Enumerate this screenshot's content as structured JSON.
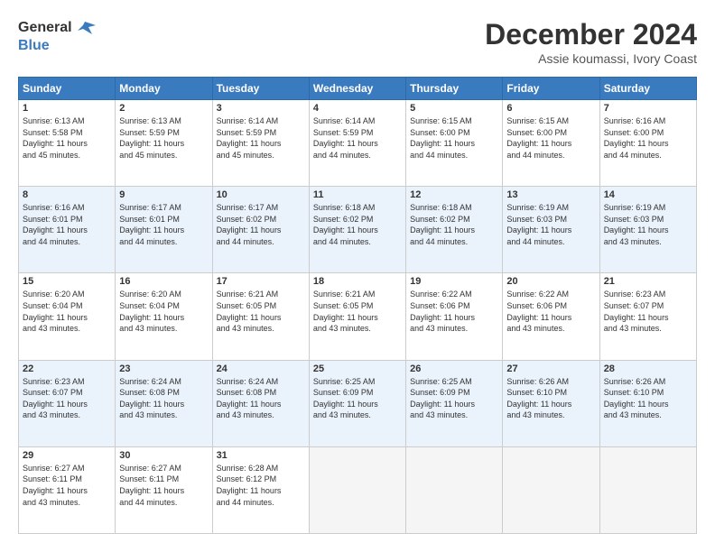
{
  "logo": {
    "line1": "General",
    "line2": "Blue"
  },
  "header": {
    "month": "December 2024",
    "location": "Assie koumassi, Ivory Coast"
  },
  "weekdays": [
    "Sunday",
    "Monday",
    "Tuesday",
    "Wednesday",
    "Thursday",
    "Friday",
    "Saturday"
  ],
  "weeks": [
    [
      {
        "day": "1",
        "info": "Sunrise: 6:13 AM\nSunset: 5:58 PM\nDaylight: 11 hours\nand 45 minutes."
      },
      {
        "day": "2",
        "info": "Sunrise: 6:13 AM\nSunset: 5:59 PM\nDaylight: 11 hours\nand 45 minutes."
      },
      {
        "day": "3",
        "info": "Sunrise: 6:14 AM\nSunset: 5:59 PM\nDaylight: 11 hours\nand 45 minutes."
      },
      {
        "day": "4",
        "info": "Sunrise: 6:14 AM\nSunset: 5:59 PM\nDaylight: 11 hours\nand 44 minutes."
      },
      {
        "day": "5",
        "info": "Sunrise: 6:15 AM\nSunset: 6:00 PM\nDaylight: 11 hours\nand 44 minutes."
      },
      {
        "day": "6",
        "info": "Sunrise: 6:15 AM\nSunset: 6:00 PM\nDaylight: 11 hours\nand 44 minutes."
      },
      {
        "day": "7",
        "info": "Sunrise: 6:16 AM\nSunset: 6:00 PM\nDaylight: 11 hours\nand 44 minutes."
      }
    ],
    [
      {
        "day": "8",
        "info": "Sunrise: 6:16 AM\nSunset: 6:01 PM\nDaylight: 11 hours\nand 44 minutes."
      },
      {
        "day": "9",
        "info": "Sunrise: 6:17 AM\nSunset: 6:01 PM\nDaylight: 11 hours\nand 44 minutes."
      },
      {
        "day": "10",
        "info": "Sunrise: 6:17 AM\nSunset: 6:02 PM\nDaylight: 11 hours\nand 44 minutes."
      },
      {
        "day": "11",
        "info": "Sunrise: 6:18 AM\nSunset: 6:02 PM\nDaylight: 11 hours\nand 44 minutes."
      },
      {
        "day": "12",
        "info": "Sunrise: 6:18 AM\nSunset: 6:02 PM\nDaylight: 11 hours\nand 44 minutes."
      },
      {
        "day": "13",
        "info": "Sunrise: 6:19 AM\nSunset: 6:03 PM\nDaylight: 11 hours\nand 44 minutes."
      },
      {
        "day": "14",
        "info": "Sunrise: 6:19 AM\nSunset: 6:03 PM\nDaylight: 11 hours\nand 43 minutes."
      }
    ],
    [
      {
        "day": "15",
        "info": "Sunrise: 6:20 AM\nSunset: 6:04 PM\nDaylight: 11 hours\nand 43 minutes."
      },
      {
        "day": "16",
        "info": "Sunrise: 6:20 AM\nSunset: 6:04 PM\nDaylight: 11 hours\nand 43 minutes."
      },
      {
        "day": "17",
        "info": "Sunrise: 6:21 AM\nSunset: 6:05 PM\nDaylight: 11 hours\nand 43 minutes."
      },
      {
        "day": "18",
        "info": "Sunrise: 6:21 AM\nSunset: 6:05 PM\nDaylight: 11 hours\nand 43 minutes."
      },
      {
        "day": "19",
        "info": "Sunrise: 6:22 AM\nSunset: 6:06 PM\nDaylight: 11 hours\nand 43 minutes."
      },
      {
        "day": "20",
        "info": "Sunrise: 6:22 AM\nSunset: 6:06 PM\nDaylight: 11 hours\nand 43 minutes."
      },
      {
        "day": "21",
        "info": "Sunrise: 6:23 AM\nSunset: 6:07 PM\nDaylight: 11 hours\nand 43 minutes."
      }
    ],
    [
      {
        "day": "22",
        "info": "Sunrise: 6:23 AM\nSunset: 6:07 PM\nDaylight: 11 hours\nand 43 minutes."
      },
      {
        "day": "23",
        "info": "Sunrise: 6:24 AM\nSunset: 6:08 PM\nDaylight: 11 hours\nand 43 minutes."
      },
      {
        "day": "24",
        "info": "Sunrise: 6:24 AM\nSunset: 6:08 PM\nDaylight: 11 hours\nand 43 minutes."
      },
      {
        "day": "25",
        "info": "Sunrise: 6:25 AM\nSunset: 6:09 PM\nDaylight: 11 hours\nand 43 minutes."
      },
      {
        "day": "26",
        "info": "Sunrise: 6:25 AM\nSunset: 6:09 PM\nDaylight: 11 hours\nand 43 minutes."
      },
      {
        "day": "27",
        "info": "Sunrise: 6:26 AM\nSunset: 6:10 PM\nDaylight: 11 hours\nand 43 minutes."
      },
      {
        "day": "28",
        "info": "Sunrise: 6:26 AM\nSunset: 6:10 PM\nDaylight: 11 hours\nand 43 minutes."
      }
    ],
    [
      {
        "day": "29",
        "info": "Sunrise: 6:27 AM\nSunset: 6:11 PM\nDaylight: 11 hours\nand 43 minutes."
      },
      {
        "day": "30",
        "info": "Sunrise: 6:27 AM\nSunset: 6:11 PM\nDaylight: 11 hours\nand 44 minutes."
      },
      {
        "day": "31",
        "info": "Sunrise: 6:28 AM\nSunset: 6:12 PM\nDaylight: 11 hours\nand 44 minutes."
      },
      {
        "day": "",
        "info": ""
      },
      {
        "day": "",
        "info": ""
      },
      {
        "day": "",
        "info": ""
      },
      {
        "day": "",
        "info": ""
      }
    ]
  ]
}
